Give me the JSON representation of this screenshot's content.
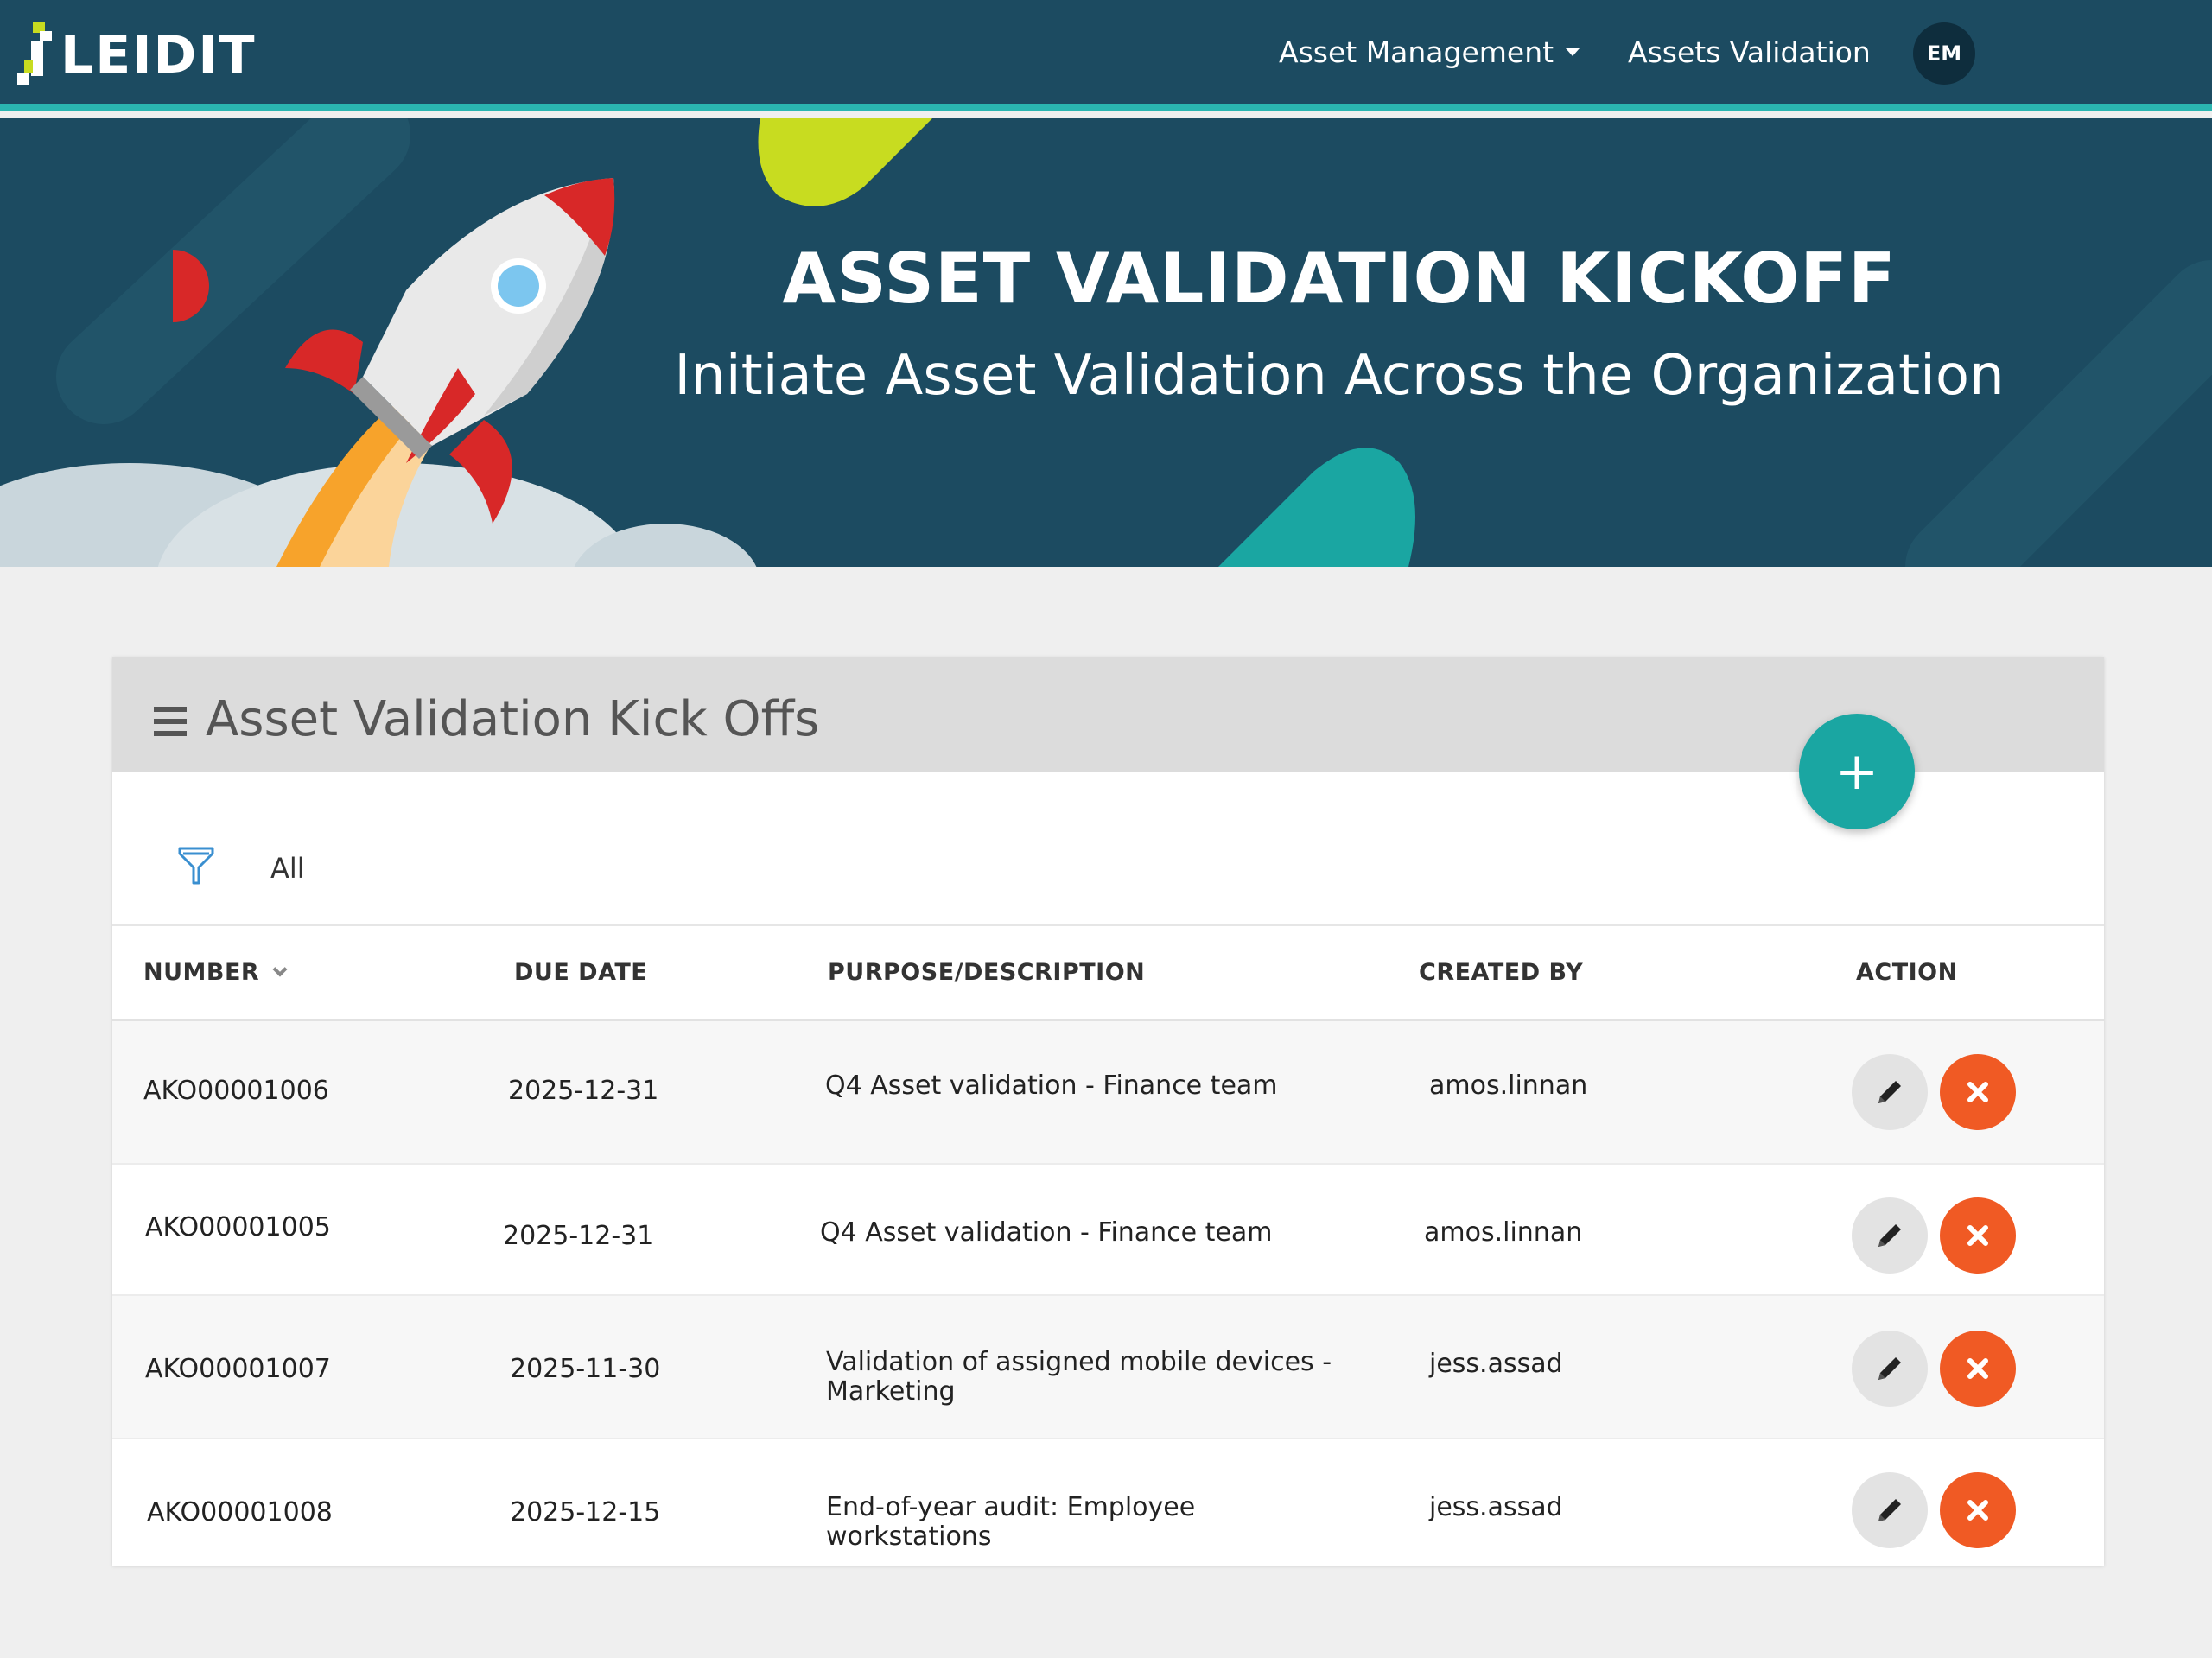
{
  "nav": {
    "logo_text": "LEIDIT",
    "asset_management": "Asset Management",
    "assets_validation": "Assets Validation",
    "avatar_initials": "EM"
  },
  "hero": {
    "title": "ASSET VALIDATION KICKOFF",
    "subtitle": "Initiate Asset Validation Across the Organization"
  },
  "panel": {
    "title": "Asset Validation Kick Offs",
    "add_label": "+",
    "filter_label": "All"
  },
  "table": {
    "headers": {
      "number": "NUMBER",
      "due_date": "DUE DATE",
      "description": "PURPOSE/DESCRIPTION",
      "created_by": "CREATED BY",
      "action": "ACTION"
    },
    "rows": [
      {
        "number": "AKO00001006",
        "due_date": "2025-12-31",
        "description": "Q4 Asset validation - Finance team",
        "created_by": "amos.linnan"
      },
      {
        "number": "AKO00001005",
        "due_date": "2025-12-31",
        "description": "Q4 Asset validation - Finance team",
        "created_by": "amos.linnan"
      },
      {
        "number": "AKO00001007",
        "due_date": "2025-11-30",
        "description": "Validation of assigned mobile devices - Marketing",
        "created_by": "jess.assad"
      },
      {
        "number": "AKO00001008",
        "due_date": "2025-12-15",
        "description": "End-of-year audit: Employee workstations",
        "created_by": "jess.assad"
      }
    ]
  },
  "colors": {
    "navy": "#1c4b61",
    "teal": "#2ab5b0",
    "delete_orange": "#f05a24",
    "lime": "#c8dc20"
  },
  "icons": [
    "caret-down-icon",
    "menu-icon",
    "filter-icon",
    "plus-icon",
    "pencil-icon",
    "close-icon",
    "rocket-illustration"
  ]
}
